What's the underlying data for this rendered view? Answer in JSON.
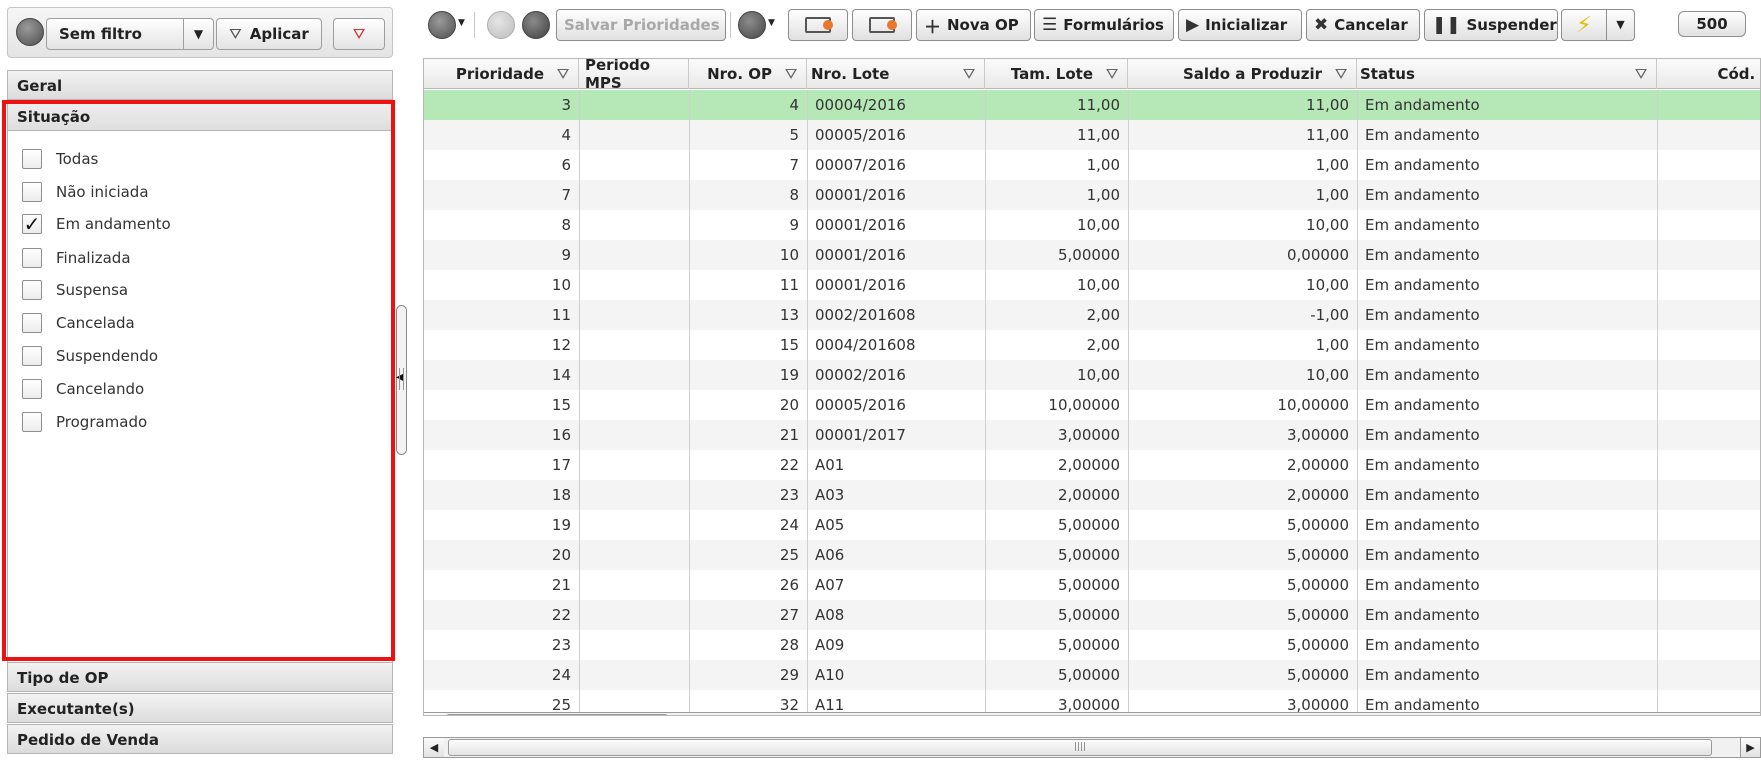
{
  "filterbar": {
    "filter_name": "Sem filtro",
    "apply_label": "Aplicar"
  },
  "accordion": {
    "geral": "Geral",
    "situacao": "Situação",
    "tipo_op": "Tipo de OP",
    "executantes": "Executante(s)",
    "pedido_venda": "Pedido de Venda"
  },
  "situacao_options": [
    {
      "label": "Todas",
      "checked": false
    },
    {
      "label": "Não iniciada",
      "checked": false
    },
    {
      "label": "Em andamento",
      "checked": true
    },
    {
      "label": "Finalizada",
      "checked": false
    },
    {
      "label": "Suspensa",
      "checked": false
    },
    {
      "label": "Cancelada",
      "checked": false
    },
    {
      "label": "Suspendendo",
      "checked": false
    },
    {
      "label": "Cancelando",
      "checked": false
    },
    {
      "label": "Programado",
      "checked": false
    }
  ],
  "toolbar": {
    "save_priorities": "Salvar Prioridades",
    "new_op": "Nova OP",
    "forms": "Formulários",
    "start": "Inicializar",
    "cancel": "Cancelar",
    "suspend": "Suspender",
    "page_size": "500"
  },
  "grid": {
    "columns": [
      "Prioridade",
      "Periodo MPS",
      "Nro. OP",
      "Nro. Lote",
      "Tam. Lote",
      "Saldo a Produzir",
      "Status",
      "Cód. I"
    ],
    "rows": [
      [
        "3",
        "",
        "4",
        "00004/2016",
        "11,00",
        "11,00",
        "Em andamento"
      ],
      [
        "4",
        "",
        "5",
        "00005/2016",
        "11,00",
        "11,00",
        "Em andamento"
      ],
      [
        "6",
        "",
        "7",
        "00007/2016",
        "1,00",
        "1,00",
        "Em andamento"
      ],
      [
        "7",
        "",
        "8",
        "00001/2016",
        "1,00",
        "1,00",
        "Em andamento"
      ],
      [
        "8",
        "",
        "9",
        "00001/2016",
        "10,00",
        "10,00",
        "Em andamento"
      ],
      [
        "9",
        "",
        "10",
        "00001/2016",
        "5,00000",
        "0,00000",
        "Em andamento"
      ],
      [
        "10",
        "",
        "11",
        "00001/2016",
        "10,00",
        "10,00",
        "Em andamento"
      ],
      [
        "11",
        "",
        "13",
        "0002/201608",
        "2,00",
        "-1,00",
        "Em andamento"
      ],
      [
        "12",
        "",
        "15",
        "0004/201608",
        "2,00",
        "1,00",
        "Em andamento"
      ],
      [
        "14",
        "",
        "19",
        "00002/2016",
        "10,00",
        "10,00",
        "Em andamento"
      ],
      [
        "15",
        "",
        "20",
        "00005/2016",
        "10,00000",
        "10,00000",
        "Em andamento"
      ],
      [
        "16",
        "",
        "21",
        "00001/2017",
        "3,00000",
        "3,00000",
        "Em andamento"
      ],
      [
        "17",
        "",
        "22",
        "A01",
        "2,00000",
        "2,00000",
        "Em andamento"
      ],
      [
        "18",
        "",
        "23",
        "A03",
        "2,00000",
        "2,00000",
        "Em andamento"
      ],
      [
        "19",
        "",
        "24",
        "A05",
        "5,00000",
        "5,00000",
        "Em andamento"
      ],
      [
        "20",
        "",
        "25",
        "A06",
        "5,00000",
        "5,00000",
        "Em andamento"
      ],
      [
        "21",
        "",
        "26",
        "A07",
        "5,00000",
        "5,00000",
        "Em andamento"
      ],
      [
        "22",
        "",
        "27",
        "A08",
        "5,00000",
        "5,00000",
        "Em andamento"
      ],
      [
        "23",
        "",
        "28",
        "A09",
        "5,00000",
        "5,00000",
        "Em andamento"
      ],
      [
        "24",
        "",
        "29",
        "A10",
        "5,00000",
        "5,00000",
        "Em andamento"
      ],
      [
        "25",
        "",
        "32",
        "A11",
        "3,00000",
        "3,00000",
        "Em andamento"
      ]
    ]
  }
}
